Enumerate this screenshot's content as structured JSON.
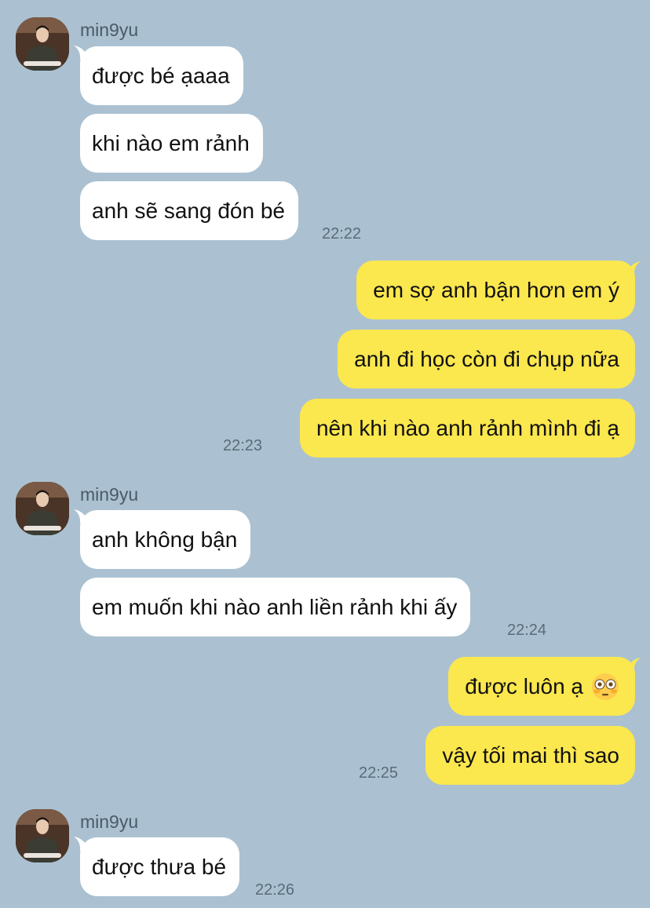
{
  "messages": [
    {
      "type": "incoming-group",
      "sender": "min9yu",
      "bubbles": [
        "được bé ạaaa",
        "khi nào em rảnh",
        "anh sẽ sang đón bé"
      ],
      "time": "22:22"
    },
    {
      "type": "outgoing-group",
      "bubbles": [
        "em sợ anh bận hơn em ý",
        "anh đi học còn đi chụp nữa",
        "nên khi nào anh rảnh mình đi ạ"
      ],
      "time": "22:23"
    },
    {
      "type": "incoming-group",
      "sender": "min9yu",
      "bubbles": [
        "anh không bận",
        "em muốn khi nào anh liền rảnh khi ấy"
      ],
      "time": "22:24"
    },
    {
      "type": "outgoing-group",
      "bubbles": [
        "được luôn ạ",
        "vậy tối mai thì sao"
      ],
      "emoji": "flushed-face-icon",
      "time": "22:25"
    },
    {
      "type": "incoming-group",
      "sender": "min9yu",
      "bubbles": [
        "được thưa bé"
      ],
      "time": "22:26"
    }
  ],
  "colors": {
    "background": "#abc1d1",
    "incoming_bubble": "#ffffff",
    "outgoing_bubble": "#fbe74e",
    "timestamp": "#5b6b78"
  }
}
